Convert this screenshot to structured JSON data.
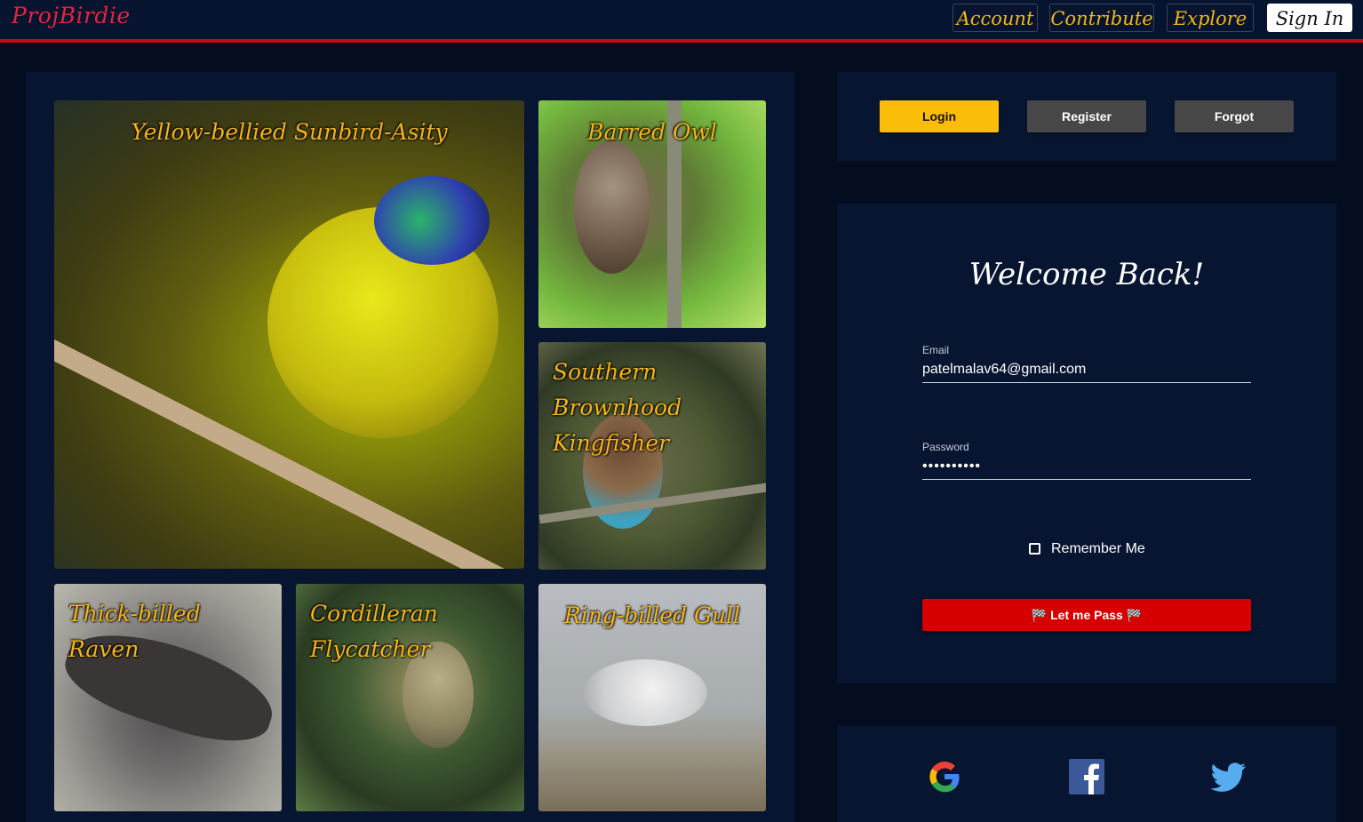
{
  "nav": {
    "brand": "ProjBirdie",
    "account": "Account",
    "contribute": "Contribute",
    "explore": "Explore",
    "signin": "Sign In"
  },
  "gallery": {
    "tiles": [
      {
        "caption": "Yellow-bellied Sunbird-Asity"
      },
      {
        "caption": "Barred Owl"
      },
      {
        "caption": "Southern Brownhood Kingfisher"
      },
      {
        "caption": "Thick-billed Raven"
      },
      {
        "caption": "Cordilleran Flycatcher"
      },
      {
        "caption": "Ring-billed Gull"
      }
    ]
  },
  "auth_tabs": {
    "login": "Login",
    "register": "Register",
    "forgot": "Forgot"
  },
  "form": {
    "heading": "Welcome Back!",
    "email_label": "Email",
    "email_value": "patelmalav64@gmail.com",
    "password_label": "Password",
    "password_value": "••••••••••",
    "remember_label": "Remember Me",
    "submit_label": "🏁 Let me Pass 🏁"
  },
  "social": {
    "icons": [
      "google-icon",
      "facebook-icon",
      "twitter-icon"
    ]
  },
  "colors": {
    "accent": "#fbbd08",
    "danger": "#d60000",
    "brand": "#e5223b",
    "panel": "#071531",
    "background": "#040d1f"
  }
}
